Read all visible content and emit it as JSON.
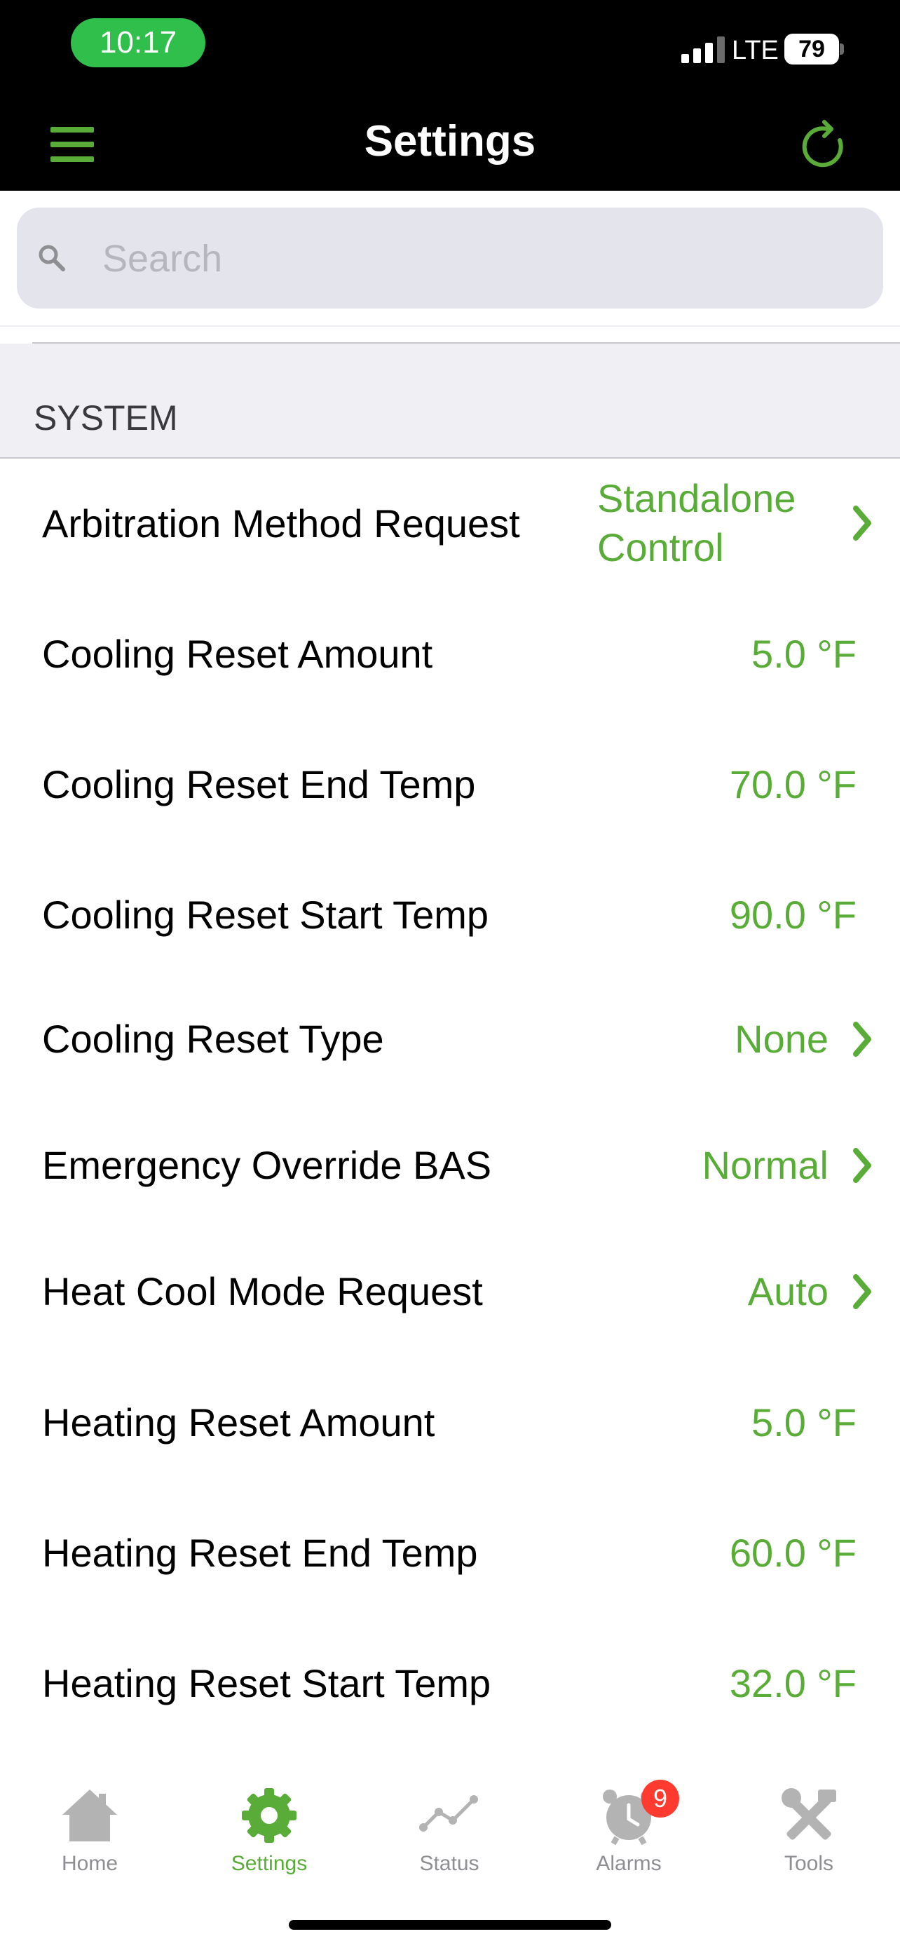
{
  "status_bar": {
    "time": "10:17",
    "network": "LTE",
    "battery": "79"
  },
  "header": {
    "title": "Settings"
  },
  "search": {
    "placeholder": "Search",
    "value": ""
  },
  "section": {
    "title": "SYSTEM"
  },
  "rows": [
    {
      "label": "Arbitration Method Request",
      "value": "Standalone Control",
      "chevron": true
    },
    {
      "label": "Cooling Reset Amount",
      "value": "5.0 °F",
      "chevron": false
    },
    {
      "label": "Cooling Reset End Temp",
      "value": "70.0 °F",
      "chevron": false
    },
    {
      "label": "Cooling Reset Start Temp",
      "value": "90.0 °F",
      "chevron": false
    },
    {
      "label": "Cooling Reset Type",
      "value": "None",
      "chevron": true
    },
    {
      "label": "Emergency Override BAS",
      "value": "Normal",
      "chevron": true
    },
    {
      "label": "Heat Cool Mode Request",
      "value": "Auto",
      "chevron": true
    },
    {
      "label": "Heating Reset Amount",
      "value": "5.0 °F",
      "chevron": false
    },
    {
      "label": "Heating Reset End Temp",
      "value": "60.0 °F",
      "chevron": false
    },
    {
      "label": "Heating Reset Start Temp",
      "value": "32.0 °F",
      "chevron": false
    }
  ],
  "tabs": [
    {
      "label": "Home",
      "icon": "home-icon",
      "active": false
    },
    {
      "label": "Settings",
      "icon": "gear-icon",
      "active": true
    },
    {
      "label": "Status",
      "icon": "line-chart-icon",
      "active": false
    },
    {
      "label": "Alarms",
      "icon": "alarm-clock-icon",
      "active": false,
      "badge": "9"
    },
    {
      "label": "Tools",
      "icon": "tools-icon",
      "active": false
    }
  ],
  "colors": {
    "accent": "#5aac38",
    "header_bg": "#000000",
    "badge": "#ff3b30",
    "time_pill": "#2fbf4a"
  }
}
